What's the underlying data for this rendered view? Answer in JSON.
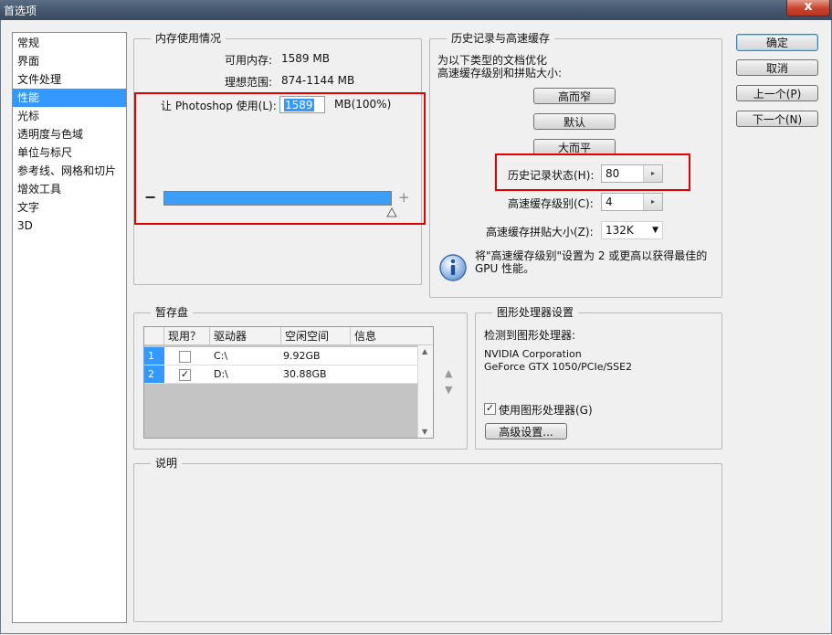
{
  "window": {
    "title": "首选项",
    "close_glyph": "x"
  },
  "sidebar": {
    "items": [
      {
        "label": "常规"
      },
      {
        "label": "界面"
      },
      {
        "label": "文件处理"
      },
      {
        "label": "性能"
      },
      {
        "label": "光标"
      },
      {
        "label": "透明度与色域"
      },
      {
        "label": "单位与标尺"
      },
      {
        "label": "参考线、网格和切片"
      },
      {
        "label": "增效工具"
      },
      {
        "label": "文字"
      },
      {
        "label": "3D"
      }
    ],
    "selected_index": 3
  },
  "memory": {
    "title": "内存使用情况",
    "available_label": "可用内存:",
    "available_value": "1589 MB",
    "ideal_label": "理想范围:",
    "ideal_value": "874-1144 MB",
    "let_label": "让 Photoshop 使用(L):",
    "let_value": "1589",
    "let_unit": "MB(100%)",
    "minus": "−",
    "plus": "+",
    "slider_fraction": 1.0
  },
  "history": {
    "title": "历史记录与高速缓存",
    "desc_line1": "为以下类型的文档优化",
    "desc_line2": "高速缓存级别和拼贴大小:",
    "btn_tall": "高而窄",
    "btn_default": "默认",
    "btn_wide": "大而平",
    "states_label": "历史记录状态(H):",
    "states_value": "80",
    "cache_label": "高速缓存级别(C):",
    "cache_value": "4",
    "tile_label": "高速缓存拼贴大小(Z):",
    "tile_value": "132K",
    "info_line1": "将\"高速缓存级别\"设置为 2 或更高以获得最佳的",
    "info_line2": "GPU 性能。"
  },
  "scratch": {
    "title": "暂存盘",
    "headers": [
      "现用？",
      "驱动器",
      "空闲空间",
      "信息"
    ],
    "rows": [
      {
        "num": "1",
        "active": false,
        "drive": "C:\\",
        "free": "9.92GB"
      },
      {
        "num": "2",
        "active": true,
        "drive": "D:\\",
        "free": "30.88GB"
      }
    ]
  },
  "gpu": {
    "title": "图形处理器设置",
    "detected_label": "检测到图形处理器:",
    "vendor": "NVIDIA Corporation",
    "model": "GeForce GTX 1050/PCIe/SSE2",
    "use_gpu_label": "使用图形处理器(G)",
    "use_gpu_checked": true,
    "advanced_btn": "高级设置..."
  },
  "description": {
    "title": "说明"
  },
  "actions": {
    "ok": "确定",
    "cancel": "取消",
    "prev": "上一个(P)",
    "next": "下一个(N)"
  }
}
